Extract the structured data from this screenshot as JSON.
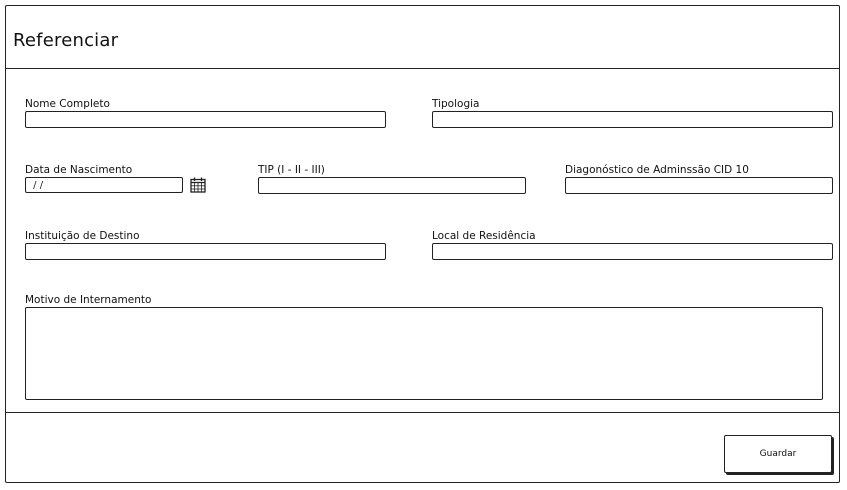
{
  "header": {
    "title": "Referenciar"
  },
  "form": {
    "nome": {
      "label": "Nome Completo",
      "value": ""
    },
    "tipologia": {
      "label": "Tipologia",
      "value": ""
    },
    "data_nascimento": {
      "label": "Data de Nascimento",
      "value": " / /"
    },
    "tip": {
      "label": "TIP (I - II - III)",
      "value": ""
    },
    "diagnostico": {
      "label": "Diagonóstico de Adminssão CID 10",
      "value": ""
    },
    "instituicao": {
      "label": "Instituição de Destino",
      "value": ""
    },
    "local_residencia": {
      "label": "Local de Residência",
      "value": ""
    },
    "motivo": {
      "label": "Motivo de Internamento",
      "value": ""
    }
  },
  "footer": {
    "save_label": "Guardar"
  },
  "icons": {
    "date_picker": "calendar-icon"
  }
}
